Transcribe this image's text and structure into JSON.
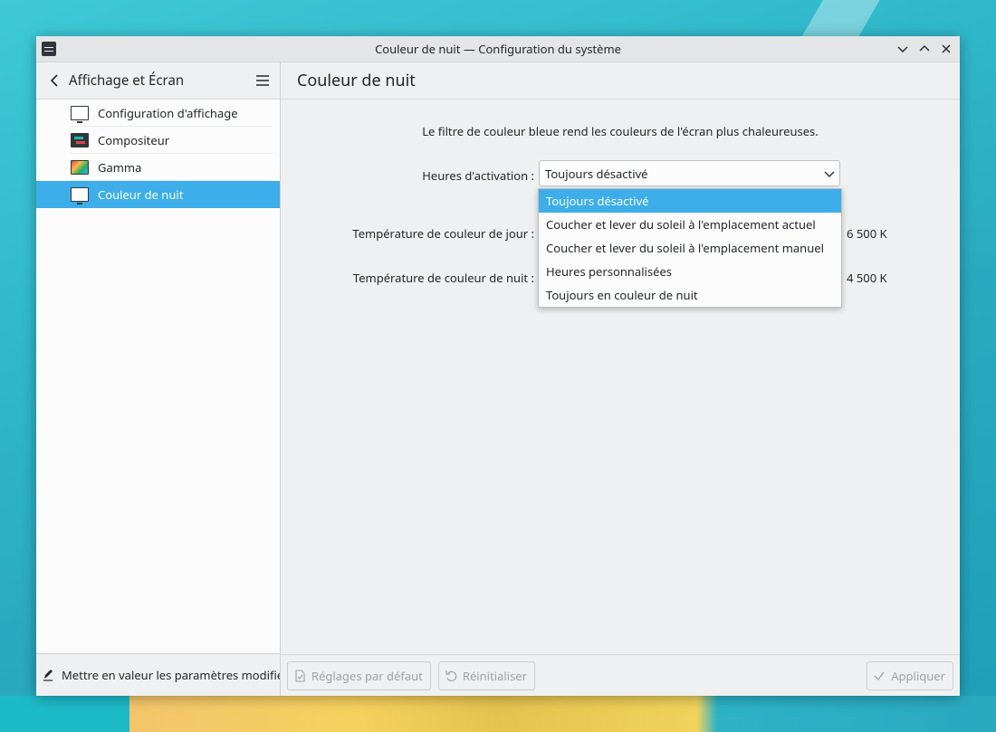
{
  "window": {
    "title": "Couleur de nuit — Configuration du système"
  },
  "sidebar": {
    "title": "Affichage et Écran",
    "items": [
      {
        "label": "Configuration d'affichage",
        "icon": "monitor-icon"
      },
      {
        "label": "Compositeur",
        "icon": "compositor-icon"
      },
      {
        "label": "Gamma",
        "icon": "gamma-icon"
      },
      {
        "label": "Couleur de nuit",
        "icon": "monitor-icon"
      }
    ],
    "active_index": 3,
    "footer_label": "Mettre en valeur les paramètres modifiés"
  },
  "main": {
    "title": "Couleur de nuit",
    "description": "Le filtre de couleur bleue rend les couleurs de l'écran plus chaleureuses.",
    "activation": {
      "label": "Heures d'activation :",
      "value": "Toujours désactivé",
      "options": [
        "Toujours désactivé",
        "Coucher et lever du soleil à l'emplacement actuel",
        "Coucher et lever du soleil à l'emplacement manuel",
        "Heures personnalisées",
        "Toujours en couleur de nuit"
      ],
      "selected_index": 0
    },
    "day_temp": {
      "label": "Température de couleur de jour :",
      "value": "6 500 K"
    },
    "night_temp": {
      "label": "Température de couleur de nuit :",
      "value": "4 500 K"
    }
  },
  "footer": {
    "defaults_label": "Réglages par défaut",
    "reset_label": "Réinitialiser",
    "apply_label": "Appliquer"
  },
  "colors": {
    "accent": "#3daee9",
    "background": "#eff0f1",
    "text": "#232629"
  }
}
